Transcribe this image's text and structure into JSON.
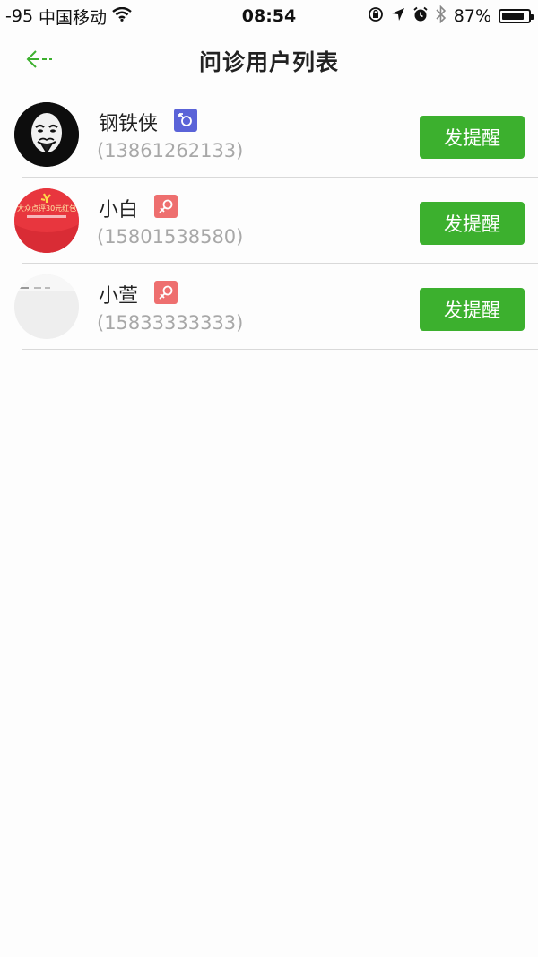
{
  "status_bar": {
    "signal": "-95",
    "carrier": "中国移动",
    "time": "08:54",
    "battery": "87%",
    "battery_level": 0.87
  },
  "nav": {
    "title": "问诊用户列表"
  },
  "users": [
    {
      "name": "钢铁侠",
      "gender": "male",
      "phone": "(13861262133)",
      "button": "发提醒"
    },
    {
      "name": "小白",
      "gender": "female",
      "phone": "(15801538580)",
      "button": "发提醒",
      "avatar_text": "大众点评30元红包"
    },
    {
      "name": "小萱",
      "gender": "female",
      "phone": "(15833333333)",
      "button": "发提醒"
    }
  ],
  "colors": {
    "accent": "#3cb02e",
    "male_badge": "#5a63d8",
    "female_badge": "#ee6f6f"
  }
}
